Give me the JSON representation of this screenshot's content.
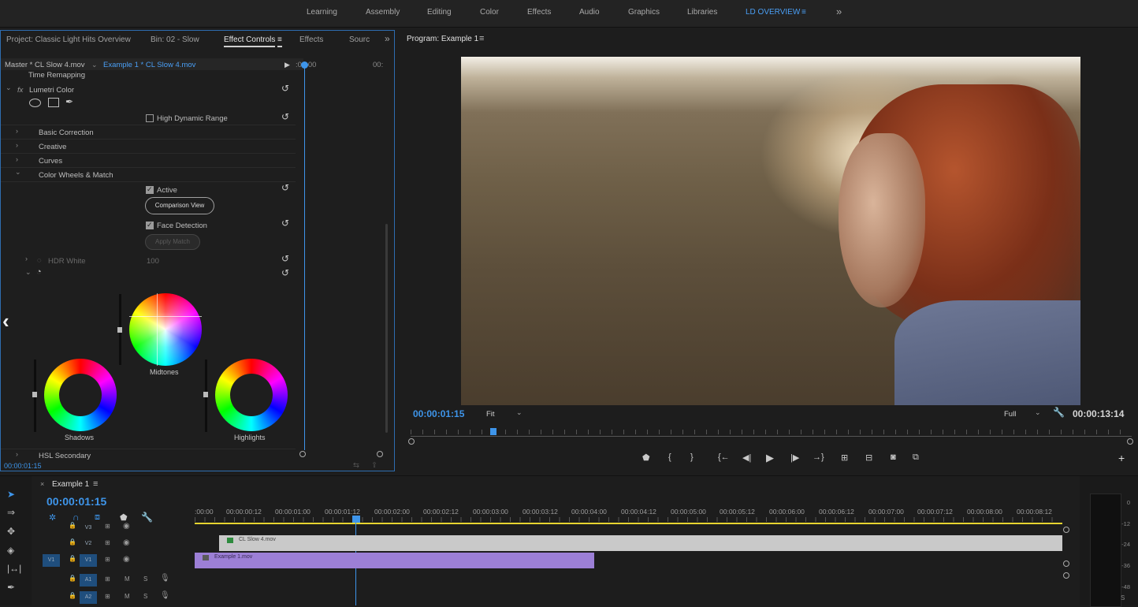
{
  "workspaces": [
    "Learning",
    "Assembly",
    "Editing",
    "Color",
    "Effects",
    "Audio",
    "Graphics",
    "Libraries",
    "LD OVERVIEW"
  ],
  "workspace_active": "LD OVERVIEW",
  "workspace_more": "»",
  "left_panel": {
    "tabs": [
      "Project: Classic Light Hits Overview",
      "Bin: 02 - Slow",
      "Effect Controls",
      "Effects",
      "Sourc"
    ],
    "active_tab": "Effect Controls",
    "tab_menu_icon": "≡",
    "overflow": "»",
    "master_label": "Master * CL Slow 4.mov",
    "sequence_label": "Example 1 * CL Slow 4.mov",
    "ruler_start": ":00:00",
    "ruler_end": "00:",
    "time_remapping": "Time Remapping",
    "effect_name": "Lumetri Color",
    "fx_label": "fx",
    "hdr_label": "High Dynamic Range",
    "sections": [
      "Basic Correction",
      "Creative",
      "Curves",
      "Color Wheels & Match"
    ],
    "active_label": "Active",
    "comparison_view": "Comparison View",
    "face_detection": "Face Detection",
    "apply_match": "Apply Match",
    "hdr_white_label": "HDR White",
    "hdr_white_value": "100",
    "wheels": [
      "Midtones",
      "Shadows",
      "Highlights"
    ],
    "hsl_secondary": "HSL Secondary",
    "timecode": "00:00:01:15"
  },
  "program": {
    "title": "Program: Example 1",
    "menu_icon": "≡",
    "timecode": "00:00:01:15",
    "zoom": "Fit",
    "resolution": "Full",
    "duration": "00:00:13:14",
    "add_button": "+"
  },
  "timeline": {
    "sequence_tab": "Example 1",
    "timecode": "00:00:01:15",
    "ruler": [
      ":00:00",
      "00:00:00:12",
      "00:00:01:00",
      "00:00:01:12",
      "00:00:02:00",
      "00:00:02:12",
      "00:00:03:00",
      "00:00:03:12",
      "00:00:04:00",
      "00:00:04:12",
      "00:00:05:00",
      "00:00:05:12",
      "00:00:06:00",
      "00:00:06:12",
      "00:00:07:00",
      "00:00:07:12",
      "00:00:08:00",
      "00:00:08:12"
    ],
    "tracks": [
      "V3",
      "V2",
      "V1",
      "A1",
      "A2"
    ],
    "source_patch": "V1",
    "clips": [
      {
        "name": "CL Slow 4.mov",
        "color": "#c9c9c9"
      },
      {
        "name": "Example 1.mov",
        "color": "#9c7fd6"
      }
    ],
    "meter_labels": [
      "0",
      "-12",
      "-24",
      "-36",
      "-48"
    ],
    "meter_mark": "S"
  },
  "colors": {
    "accent": "#3e95ea",
    "playhead": "#3e95ea",
    "work_area": "#e6d430"
  }
}
